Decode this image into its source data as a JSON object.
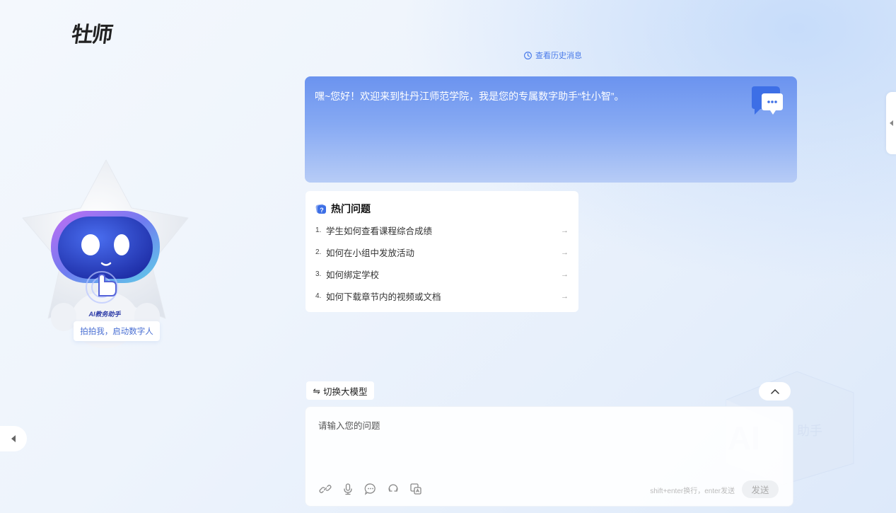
{
  "brand": {
    "logo_text": "牡师"
  },
  "history": {
    "label": "查看历史消息"
  },
  "welcome": {
    "message": "嘿~您好！欢迎来到牡丹江师范学院，我是您的专属数字助手“牡小智”。"
  },
  "hot_questions": {
    "title": "热门问题",
    "items": [
      {
        "num": "1.",
        "text": "学生如何查看课程综合成绩",
        "arrow": "→"
      },
      {
        "num": "2.",
        "text": "如何在小组中发放活动",
        "arrow": "→"
      },
      {
        "num": "3.",
        "text": "如何绑定学校",
        "arrow": "→"
      },
      {
        "num": "4.",
        "text": "如何下载章节内的视频或文档",
        "arrow": "→"
      }
    ]
  },
  "robot": {
    "badge": "AI教务助手",
    "button_label": "拍拍我，启动数字人"
  },
  "switch_model": {
    "icon": "⇋",
    "label": "切换大模型"
  },
  "input": {
    "placeholder": "请输入您的问题",
    "hint": "shift+enter换行，enter发送",
    "send_label": "发送",
    "tools": [
      "link-icon",
      "microphone-icon",
      "chat-bubble-icon",
      "refresh-icon",
      "translate-icon"
    ]
  },
  "background": {
    "watermark": "AI",
    "watermark_sub": "助手"
  },
  "colors": {
    "accent": "#4a7bea",
    "welcome_top": "#6b93ef",
    "welcome_bottom": "#b7ccf6"
  }
}
